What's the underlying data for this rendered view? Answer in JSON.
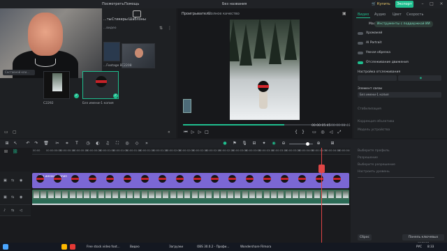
{
  "app": {
    "menu": [
      "Посмотреть",
      "Помощь"
    ],
    "window_title": "Без названия",
    "buy_label": "Купить",
    "export_label": "Экспорт",
    "accent": "#1fbf8f"
  },
  "left_panel": {
    "tabs": [
      {
        "label": "...ты"
      },
      {
        "label": "Стикеры"
      },
      {
        "label": "Шаблоны"
      }
    ],
    "section_label": "...видео",
    "folder_placeholder": "Составной кли...",
    "media": [
      {
        "label": "...Footage By..."
      },
      {
        "label": "C2208"
      },
      {
        "label": "C2292"
      },
      {
        "label": "Без имени-1 копия"
      }
    ]
  },
  "player": {
    "label": "Проигрыватель",
    "quality": "Полное качество",
    "current_time": "00:00:05:45",
    "total_time": "00:00:08:46",
    "progress": 0.62
  },
  "right_panel": {
    "tabs": [
      "Видео",
      "Аудио",
      "Цвет",
      "Скорость"
    ],
    "subtabs": [
      "Маска",
      "Инструменты с поддержкой ИИ"
    ],
    "toggles": [
      {
        "label": "Хромакей",
        "on": false
      },
      {
        "label": "AI Portrait",
        "on": false
      },
      {
        "label": "Умная обрезка",
        "on": false
      },
      {
        "label": "Отслеживание движения",
        "on": true
      }
    ],
    "tracking_label": "Настройка отслеживания",
    "element_label": "Элемент связи",
    "element_value": "Без имени-1 копия",
    "dim_rows": [
      "Стабилизация",
      "Коррекция объектива",
      "Модель устройства",
      "Выберите профиль",
      "Разрешение",
      "Выберите разрешение",
      "Настроить уровень"
    ],
    "bottom_buttons": [
      "Сброс",
      "Панель ключевых кадров"
    ]
  },
  "timeline": {
    "ruler_ticks": [
      "00:00",
      "00:00:00:05",
      "00:00:00:10",
      "00:00:00:15",
      "00:00:00:20",
      "00:00:01:00",
      "00:00:01:05",
      "00:00:01:10",
      "00:00:01:15",
      "00:00:01:20",
      "00:00:02:00",
      "00:00:02:05",
      "00:00:02:10",
      "00:00:02:15",
      "00:00:02:20",
      "00:00:03:00",
      "00:00:03:05",
      "00:00:03:10",
      "00:00:03:15",
      "00:00:03:20",
      "00:00:04:00",
      "00:00:04:05",
      "00:00:04:10",
      "00:00:04:15"
    ],
    "clip_label": "Без имени-1 копия",
    "clip_color": "#7b67d4",
    "snow_clip_color": "#3e6d58"
  },
  "taskbar": {
    "items": [
      "Free stock video foot...",
      "Видео",
      "Загрузки",
      "OBS 30.0.2 - Профи...",
      "Wondershare Filmora"
    ],
    "lang": "РУС",
    "clock": "8:33"
  }
}
